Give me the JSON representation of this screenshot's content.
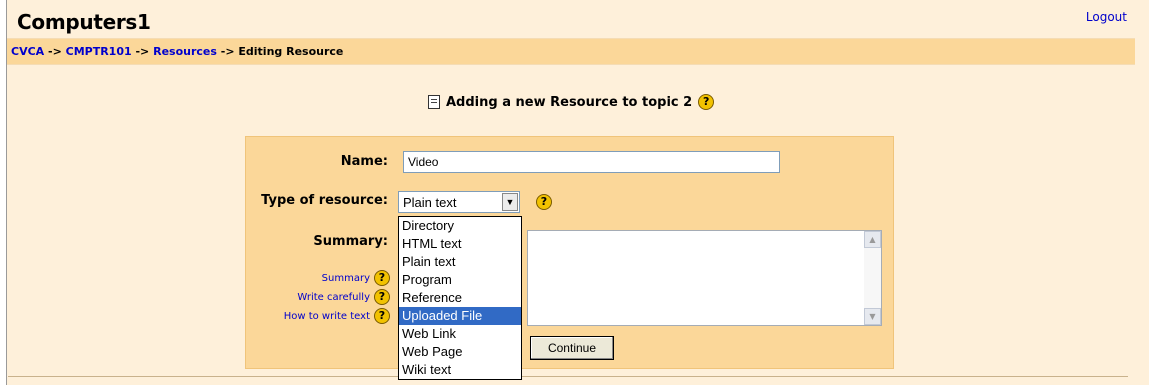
{
  "header": {
    "site_title": "Computers1",
    "logout_label": "Logout"
  },
  "breadcrumb": {
    "items": [
      "CVCA",
      "CMPTR101",
      "Resources"
    ],
    "separator": " -> ",
    "current": "Editing Resource"
  },
  "page": {
    "heading": "Adding a new Resource to topic 2"
  },
  "form": {
    "name_label": "Name:",
    "name_value": "Video",
    "type_label": "Type of resource:",
    "type_selected": "Plain text",
    "summary_label": "Summary:",
    "help_links": [
      "Summary",
      "Write carefully",
      "How to write text"
    ],
    "continue_label": "Continue"
  },
  "dropdown": {
    "options": [
      "Directory",
      "HTML text",
      "Plain text",
      "Program",
      "Reference",
      "Uploaded File",
      "Web Link",
      "Web Page",
      "Wiki text"
    ],
    "highlighted": "Uploaded File"
  },
  "icons": {
    "help": "help-icon",
    "resource": "document-icon"
  },
  "colors": {
    "page_bg": "#fef0da",
    "navbar_bg": "#fbd799",
    "link": "#0000cc",
    "selection": "#316ac5"
  }
}
